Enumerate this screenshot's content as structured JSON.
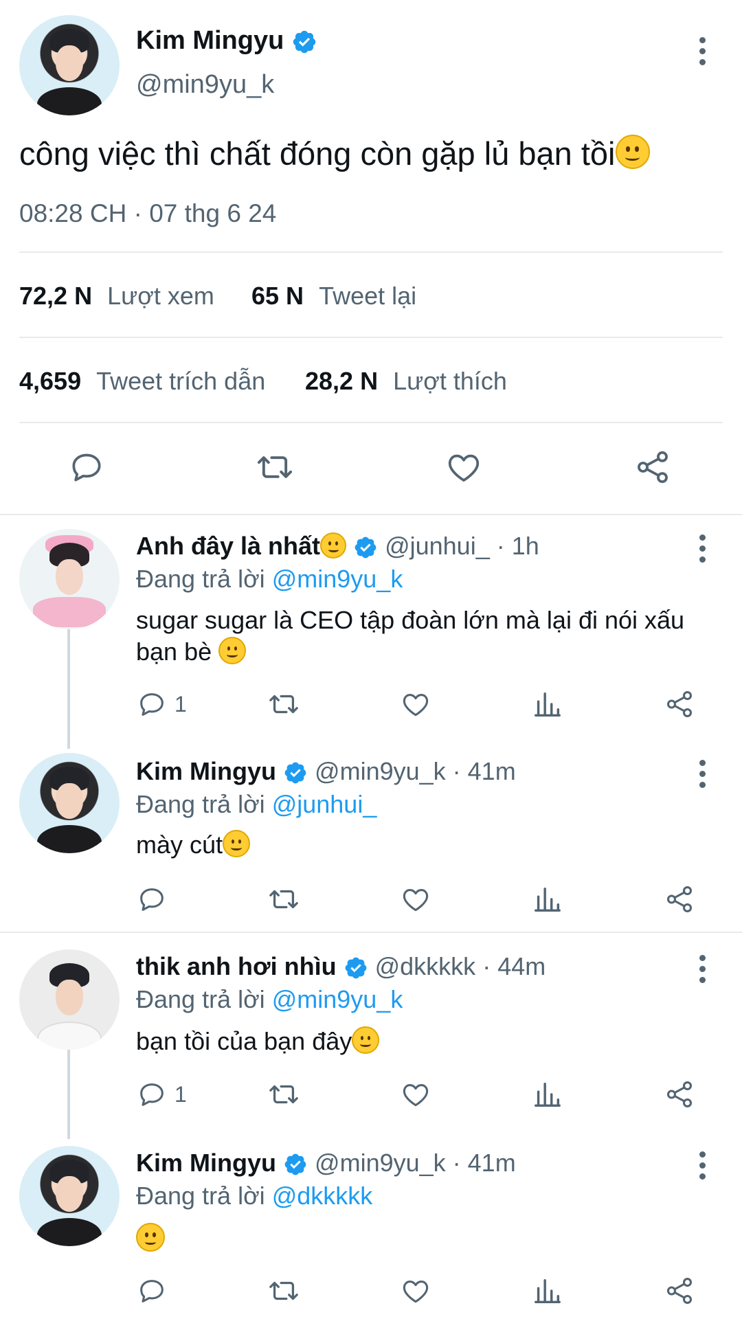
{
  "main_tweet": {
    "author_name": "Kim Mingyu",
    "handle": "@min9yu_k",
    "text": "công việc thì chất đóng còn gặp lủ bạn tồi",
    "timestamp": "08:28 CH · 07 thg 6 24",
    "stats": {
      "views_count": "72,2 N",
      "views_label": "Lượt xem",
      "retweets_count": "65 N",
      "retweets_label": "Tweet lại",
      "quotes_count": "4,659",
      "quotes_label": "Tweet trích dẫn",
      "likes_count": "28,2 N",
      "likes_label": "Lượt thích"
    }
  },
  "replies": [
    {
      "author_name": "Anh đây là nhất",
      "handle": "@junhui_",
      "time": "· 1h",
      "replying_prefix": "Đang trả lời",
      "replying_to": "@min9yu_k",
      "text": "sugar sugar là CEO tập đoàn lớn mà lại đi nói xấu bạn bè",
      "reply_count": "1"
    },
    {
      "author_name": "Kim Mingyu",
      "handle": "@min9yu_k",
      "time": "· 41m",
      "replying_prefix": "Đang trả lời",
      "replying_to": "@junhui_",
      "text": "mày cút",
      "reply_count": ""
    },
    {
      "author_name": "thik anh hơi nhìu",
      "handle": "@dkkkkk",
      "time": "· 44m",
      "replying_prefix": "Đang trả lời",
      "replying_to": "@min9yu_k",
      "text": "bạn tồi của bạn đây",
      "reply_count": "1"
    },
    {
      "author_name": "Kim Mingyu",
      "handle": "@min9yu_k",
      "time": "· 41m",
      "replying_prefix": "Đang trả lời",
      "replying_to": "@dkkkkk",
      "text": "",
      "reply_count": ""
    }
  ],
  "icons": [
    "reply-icon",
    "retweet-icon",
    "like-icon",
    "share-icon",
    "analytics-icon",
    "more-icon",
    "verified-badge-icon"
  ],
  "colors": {
    "accent": "#1d9bf0",
    "muted": "#536471",
    "text": "#0f1419",
    "divider": "#e7e9ea"
  }
}
